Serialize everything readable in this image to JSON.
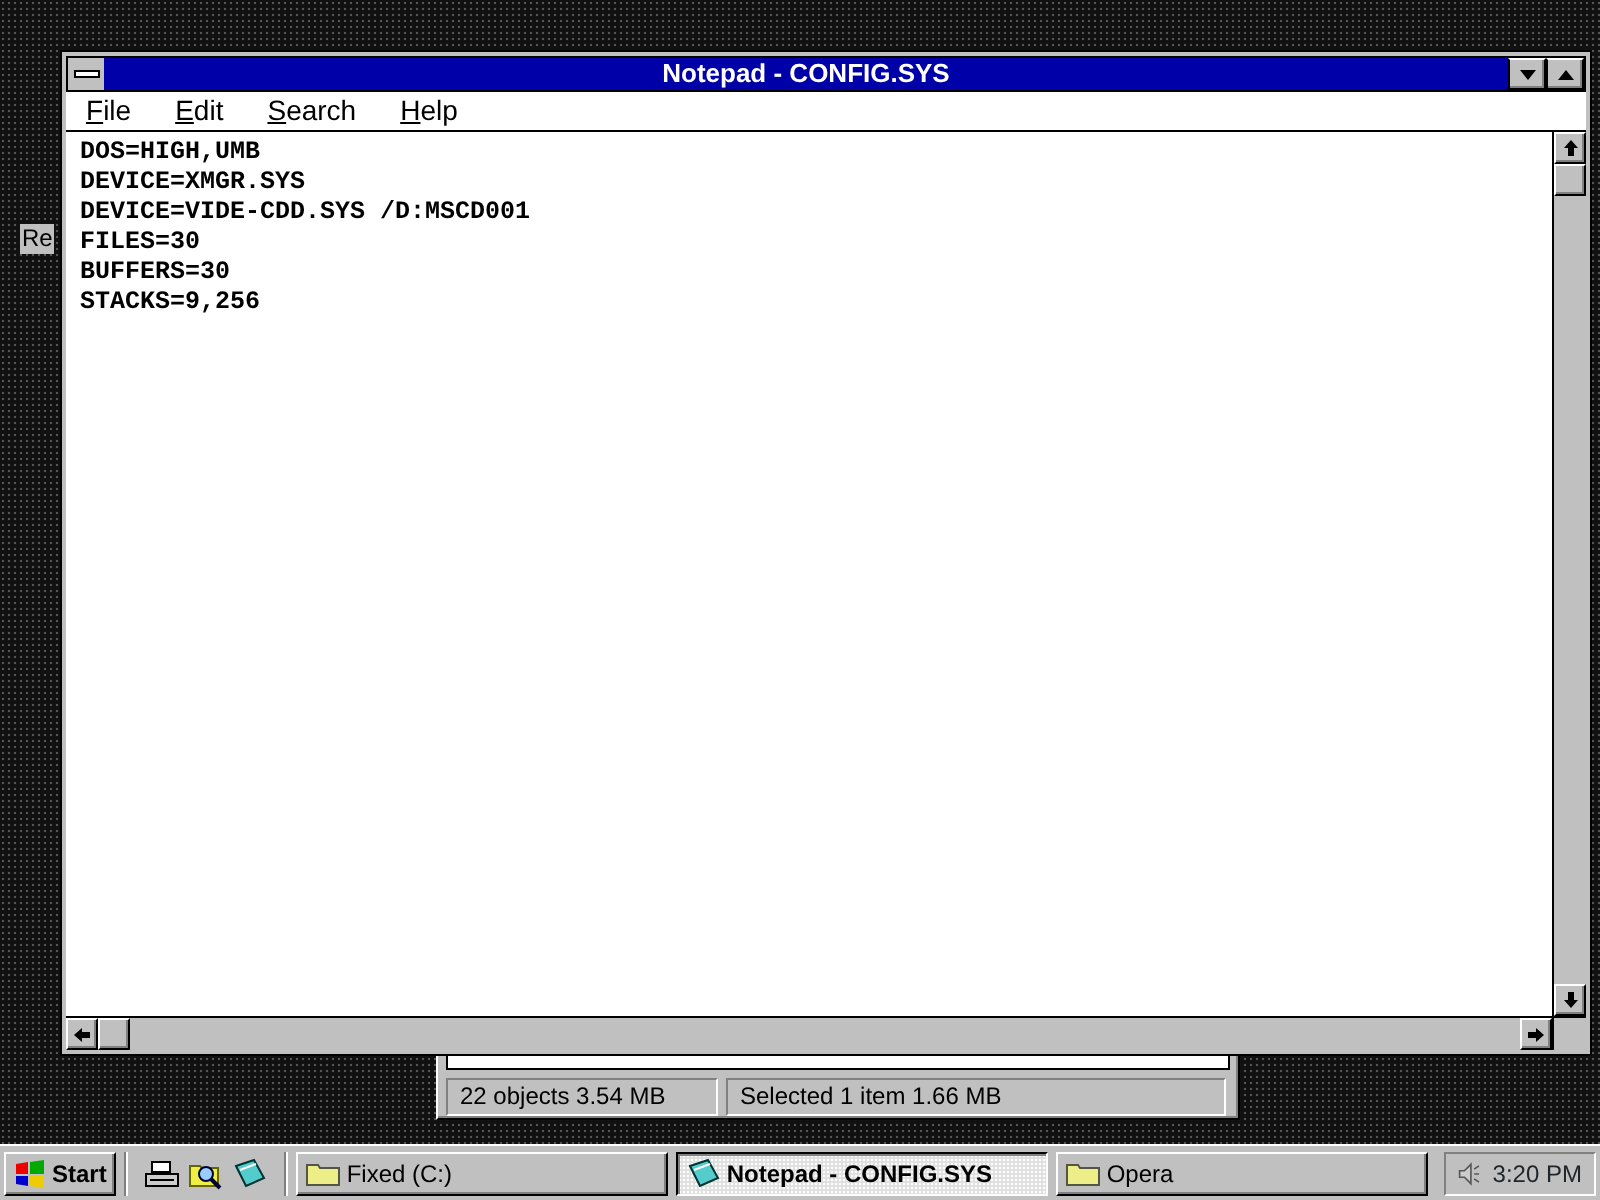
{
  "desktop": {
    "icon_label": "Re"
  },
  "explorer_status": {
    "panes": [
      "22 objects  3.54 MB",
      "Selected 1 item  1.66 MB"
    ]
  },
  "window": {
    "title": "Notepad - CONFIG.SYS",
    "active": true
  },
  "menu": [
    "File",
    "Edit",
    "Search",
    "Help"
  ],
  "document": {
    "lines": [
      "DOS=HIGH,UMB",
      "DEVICE=XMGR.SYS",
      "DEVICE=VIDE-CDD.SYS /D:MSCD001",
      "FILES=30",
      "BUFFERS=30",
      "STACKS=9,256"
    ]
  },
  "taskbar": {
    "start": "Start",
    "tasks": [
      {
        "label": "Fixed (C:)",
        "kind": "folder",
        "selected": false
      },
      {
        "label": "Notepad - CONFIG.SYS",
        "kind": "notepad",
        "selected": true
      },
      {
        "label": "Opera",
        "kind": "folder",
        "selected": false
      }
    ],
    "clock": "3:20 PM"
  }
}
